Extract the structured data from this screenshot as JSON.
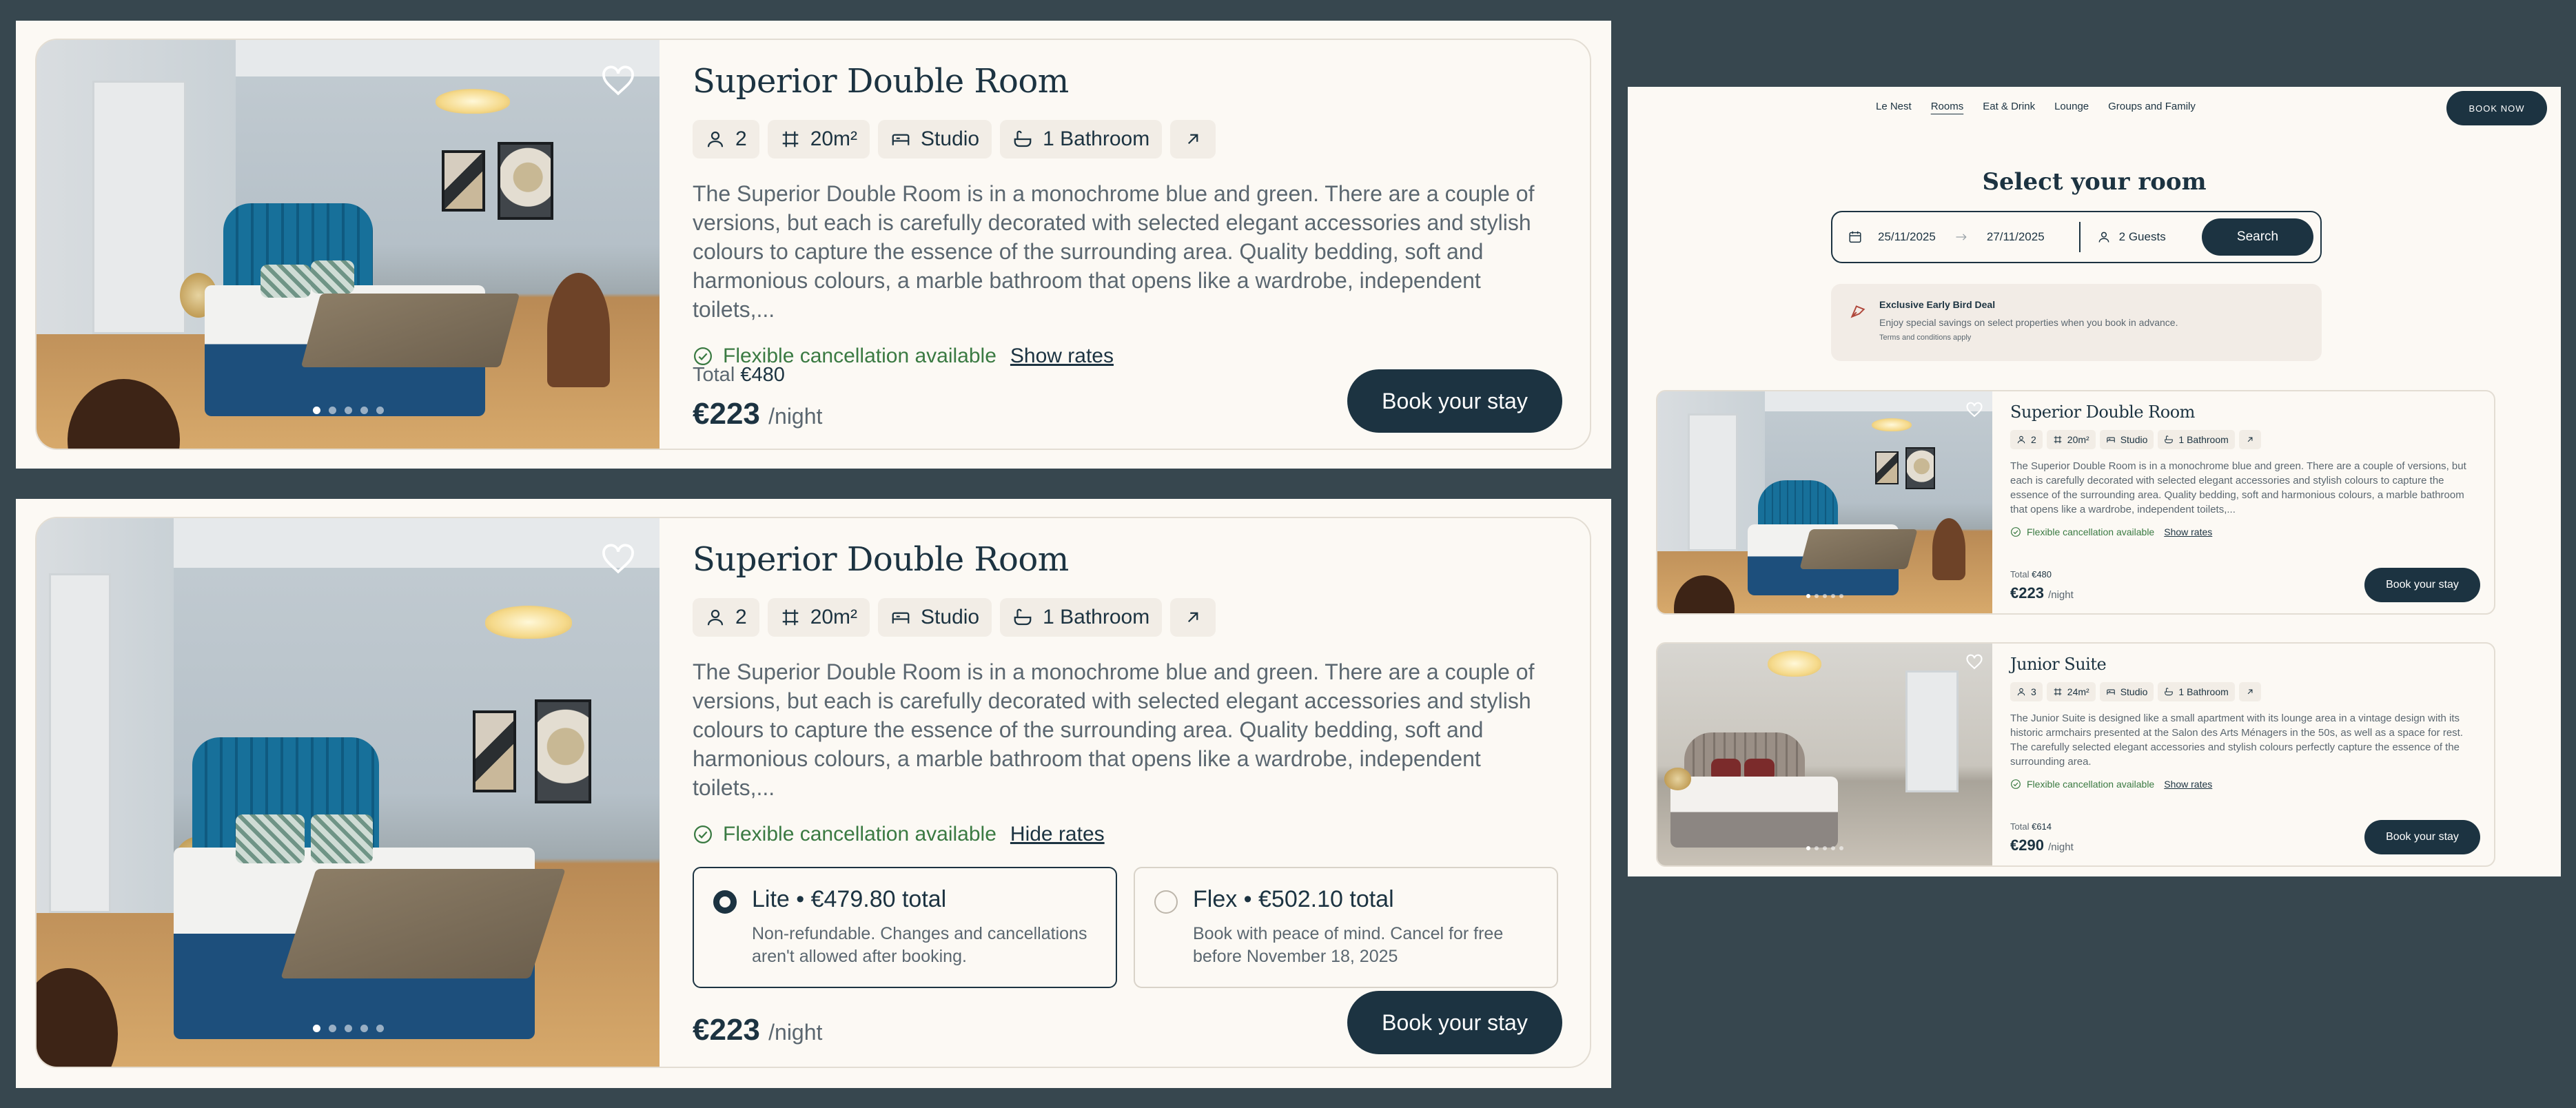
{
  "room_card_a": {
    "title": "Superior Double Room",
    "chips": {
      "guests": "2",
      "area": "20m²",
      "type": "Studio",
      "bath": "1 Bathroom"
    },
    "description": "The Superior Double Room is in a monochrome blue and green. There are a couple of versions, but each is carefully decorated with selected elegant accessories and stylish colours to capture the essence of the surrounding area. Quality bedding, soft and harmonious colours, a marble bathroom that opens like a wardrobe, independent toilets,...",
    "cancellation": "Flexible cancellation available",
    "rates_link": "Show rates",
    "total_label": "Total",
    "total_value": "€480",
    "price": "€223",
    "per_night": "/night",
    "book_label": "Book your stay"
  },
  "room_card_b": {
    "title": "Superior Double Room",
    "chips": {
      "guests": "2",
      "area": "20m²",
      "type": "Studio",
      "bath": "1 Bathroom"
    },
    "description": "The Superior Double Room is in a monochrome blue and green. There are a couple of versions, but each is carefully decorated with selected elegant accessories and stylish colours to capture the essence of the surrounding area. Quality bedding, soft and harmonious colours, a marble bathroom that opens like a wardrobe, independent toilets,...",
    "cancellation": "Flexible cancellation available",
    "rates_link": "Hide rates",
    "rates": [
      {
        "title": "Lite • €479.80 total",
        "desc": "Non-refundable. Changes and cancellations aren't allowed after booking.",
        "selected": true
      },
      {
        "title": "Flex • €502.10 total",
        "desc": "Book with peace of mind. Cancel for free before November 18, 2025",
        "selected": false
      }
    ],
    "price": "€223",
    "per_night": "/night",
    "book_label": "Book your stay"
  },
  "site": {
    "nav": [
      "Le Nest",
      "Rooms",
      "Eat & Drink",
      "Lounge",
      "Groups and Family"
    ],
    "nav_active": "Rooms",
    "book_now": "BOOK NOW",
    "heading": "Select your room",
    "search": {
      "check_in": "25/11/2025",
      "check_out": "27/11/2025",
      "guests": "2 Guests",
      "button": "Search"
    },
    "deal": {
      "title": "Exclusive Early Bird Deal",
      "desc": "Enjoy special savings on select properties when you book in advance.",
      "terms": "Terms and conditions apply"
    },
    "rooms": [
      {
        "title": "Superior Double Room",
        "chips": {
          "guests": "2",
          "area": "20m²",
          "type": "Studio",
          "bath": "1 Bathroom"
        },
        "description": "The Superior Double Room is in a monochrome blue and green. There are a couple of versions, but each is carefully decorated with selected elegant accessories and stylish colours to capture the essence of the surrounding area. Quality bedding, soft and harmonious colours, a marble bathroom that opens like a wardrobe, independent toilets,...",
        "cancellation": "Flexible cancellation available",
        "rates_link": "Show rates",
        "total_label": "Total",
        "total_value": "€480",
        "price": "€223",
        "per_night": "/night",
        "book_label": "Book your stay"
      },
      {
        "title": "Junior Suite",
        "chips": {
          "guests": "3",
          "area": "24m²",
          "type": "Studio",
          "bath": "1 Bathroom"
        },
        "description": "The Junior Suite is designed like a small apartment with its lounge area in a vintage design with its historic armchairs presented at the Salon des Arts Ménagers in the 50s, as well as a space for rest. The carefully selected elegant accessories and stylish colours perfectly capture the essence of the surrounding area.",
        "cancellation": "Flexible cancellation available",
        "rates_link": "Show rates",
        "total_label": "Total",
        "total_value": "€614",
        "price": "€290",
        "per_night": "/night",
        "book_label": "Book your stay"
      }
    ]
  },
  "colors": {
    "primary": "#1c3341",
    "success": "#3a7a42",
    "surface": "#fcf9f4",
    "backdrop": "#37474f"
  }
}
